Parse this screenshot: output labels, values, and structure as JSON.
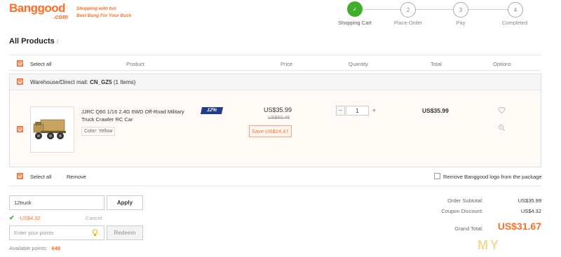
{
  "brand": {
    "logo_word": "Banggood",
    "logo_com": ".com",
    "tagline_1": "Shopping with fun",
    "tagline_2": "Best Bang For Your Buck"
  },
  "steps": [
    {
      "index": "✓",
      "label": "Shopping Cart",
      "active": true
    },
    {
      "index": "2",
      "label": "Place Order",
      "active": false
    },
    {
      "index": "3",
      "label": "Pay",
      "active": false
    },
    {
      "index": "4",
      "label": "Completed",
      "active": false
    }
  ],
  "page_title": "All Products",
  "page_title_sep": "/",
  "columns": {
    "select_all": "Select all",
    "product": "Product",
    "price": "Price",
    "quantity": "Quantity",
    "total": "Total",
    "options": "Options"
  },
  "warehouse": {
    "label": "Warehouse/Direct mail: ",
    "code": "CN_GZ5",
    "count": "(1 Items)"
  },
  "item": {
    "title": "JJRC Q60 1/16 2.4G 6WD Off-Road Military Truck Crawler RC Car",
    "color": "Color: Yellow",
    "badge": "12%",
    "price": "US$35.99",
    "old_price": "US$60.46",
    "save": "Save US$24.47",
    "quantity": "1",
    "total": "US$35.99"
  },
  "footer_actions": {
    "select_all": "Select all",
    "remove": "Remove",
    "remove_logo": "Remove Banggood logo from the package"
  },
  "coupon": {
    "value": "12truck",
    "apply": "Apply",
    "discount": "-US$4.32",
    "cancel": "Cancel"
  },
  "points": {
    "placeholder": "Enter your points",
    "redeem": "Redeem",
    "available_label": "Available points:",
    "available_value": "648"
  },
  "summary": {
    "subtotal_label": "Order Subtotal:",
    "subtotal_value": "US$35.99",
    "coupon_label": "Coupon Discount:",
    "coupon_value": "US$4.32",
    "grand_label": "Grand Total:",
    "grand_value": "US$31.67"
  },
  "watermark": "MY",
  "colors": {
    "accent": "#ff6e26",
    "success": "#3fae2a"
  }
}
